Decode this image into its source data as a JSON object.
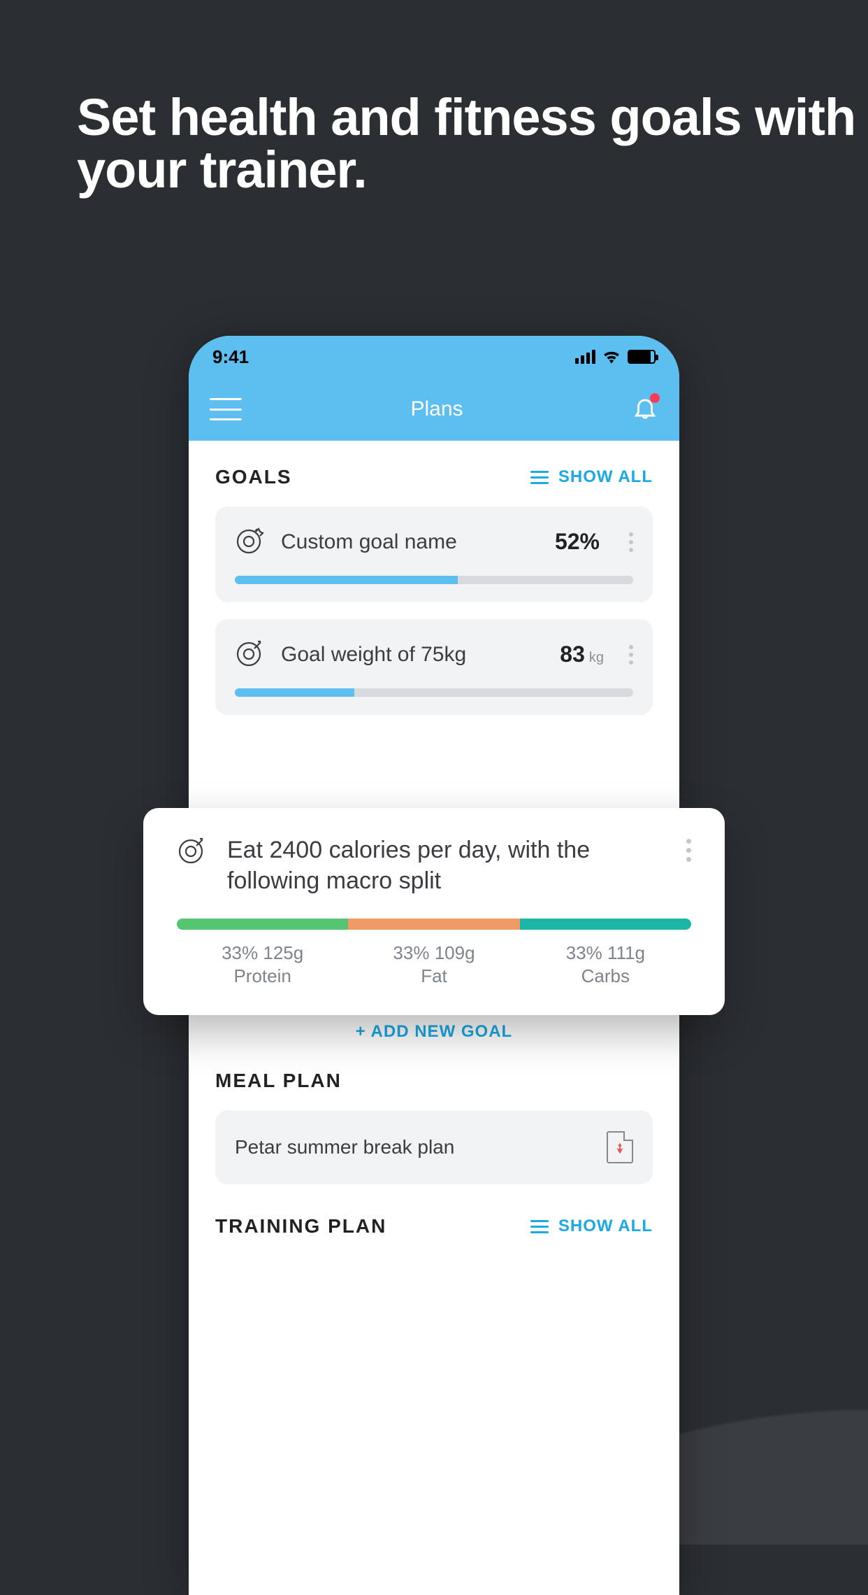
{
  "promo": {
    "heading": "Set health and fitness goals with your trainer."
  },
  "status": {
    "time": "9:41"
  },
  "nav": {
    "title": "Plans"
  },
  "sections": {
    "goals_title": "GOALS",
    "show_all": "SHOW ALL",
    "meal_title": "MEAL PLAN",
    "training_title": "TRAINING PLAN"
  },
  "goals": [
    {
      "name": "Custom goal name",
      "value": "52%",
      "unit": "",
      "progress": 56
    },
    {
      "name": "Goal weight of 75kg",
      "value": "83",
      "unit": "kg",
      "progress": 30
    },
    {
      "name": "Eat 2400 calories per day",
      "value": "",
      "unit": "",
      "progress": null
    }
  ],
  "overlay_goal": {
    "title": "Eat 2400 calories per day, with the following macro split",
    "macros": [
      {
        "pct": "33%",
        "amount": "125g",
        "label": "Protein"
      },
      {
        "pct": "33%",
        "amount": "109g",
        "label": "Fat"
      },
      {
        "pct": "33%",
        "amount": "111g",
        "label": "Carbs"
      }
    ]
  },
  "add_goal_label": "+ ADD NEW GOAL",
  "meal": {
    "name": "Petar summer break plan"
  }
}
